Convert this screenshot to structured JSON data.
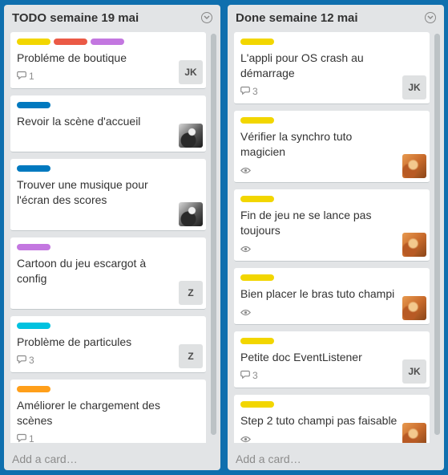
{
  "colors": {
    "board_background": "#0f6fae",
    "list_background": "#e2e4e6",
    "card_background": "#ffffff",
    "label_yellow": "#f2d600",
    "label_red": "#eb5a46",
    "label_purple": "#c377e0",
    "label_blue": "#0079bf",
    "label_sky": "#00c2e0",
    "label_orange": "#ff9f1a"
  },
  "lists": [
    {
      "title": "TODO semaine 19 mai",
      "add_card": "Add a card…",
      "cards": [
        {
          "labels": [
            "#f2d600",
            "#eb5a46",
            "#c377e0"
          ],
          "title": "Probléme de boutique",
          "comments": "1",
          "member": "JK",
          "member_type": "initials"
        },
        {
          "labels": [
            "#0079bf"
          ],
          "title": "Revoir la scène d'accueil",
          "comments": "",
          "member": "",
          "member_type": "photo-dark"
        },
        {
          "labels": [
            "#0079bf"
          ],
          "title": "Trouver une musique pour l'écran des scores",
          "comments": "",
          "member": "",
          "member_type": "photo-dark"
        },
        {
          "labels": [
            "#c377e0"
          ],
          "title": "Cartoon du jeu escargot à config",
          "comments": "",
          "member": "Z",
          "member_type": "initials"
        },
        {
          "labels": [
            "#00c2e0"
          ],
          "title": "Problème de particules",
          "comments": "3",
          "member": "Z",
          "member_type": "initials"
        },
        {
          "labels": [
            "#ff9f1a"
          ],
          "title": "Améliorer le chargement des scènes",
          "comments": "1",
          "member": "",
          "member_type": "none"
        }
      ]
    },
    {
      "title": "Done semaine 12 mai",
      "add_card": "Add a card…",
      "cards": [
        {
          "labels": [
            "#f2d600"
          ],
          "title": "L'appli pour OS crash au démarrage",
          "comments": "3",
          "watch": false,
          "member": "JK",
          "member_type": "initials"
        },
        {
          "labels": [
            "#f2d600"
          ],
          "title": "Vérifier la synchro tuto magicien",
          "comments": "",
          "watch": true,
          "member": "",
          "member_type": "photo-cat"
        },
        {
          "labels": [
            "#f2d600"
          ],
          "title": "Fin de jeu ne se lance pas toujours",
          "comments": "",
          "watch": true,
          "member": "",
          "member_type": "photo-cat"
        },
        {
          "labels": [
            "#f2d600"
          ],
          "title": "Bien placer le bras tuto champi",
          "comments": "",
          "watch": true,
          "member": "",
          "member_type": "photo-cat"
        },
        {
          "labels": [
            "#f2d600"
          ],
          "title": "Petite doc EventListener",
          "comments": "3",
          "watch": false,
          "member": "JK",
          "member_type": "initials"
        },
        {
          "labels": [
            "#f2d600"
          ],
          "title": "Step 2 tuto champi pas faisable",
          "comments": "",
          "watch": true,
          "member": "",
          "member_type": "photo-cat"
        }
      ]
    }
  ]
}
